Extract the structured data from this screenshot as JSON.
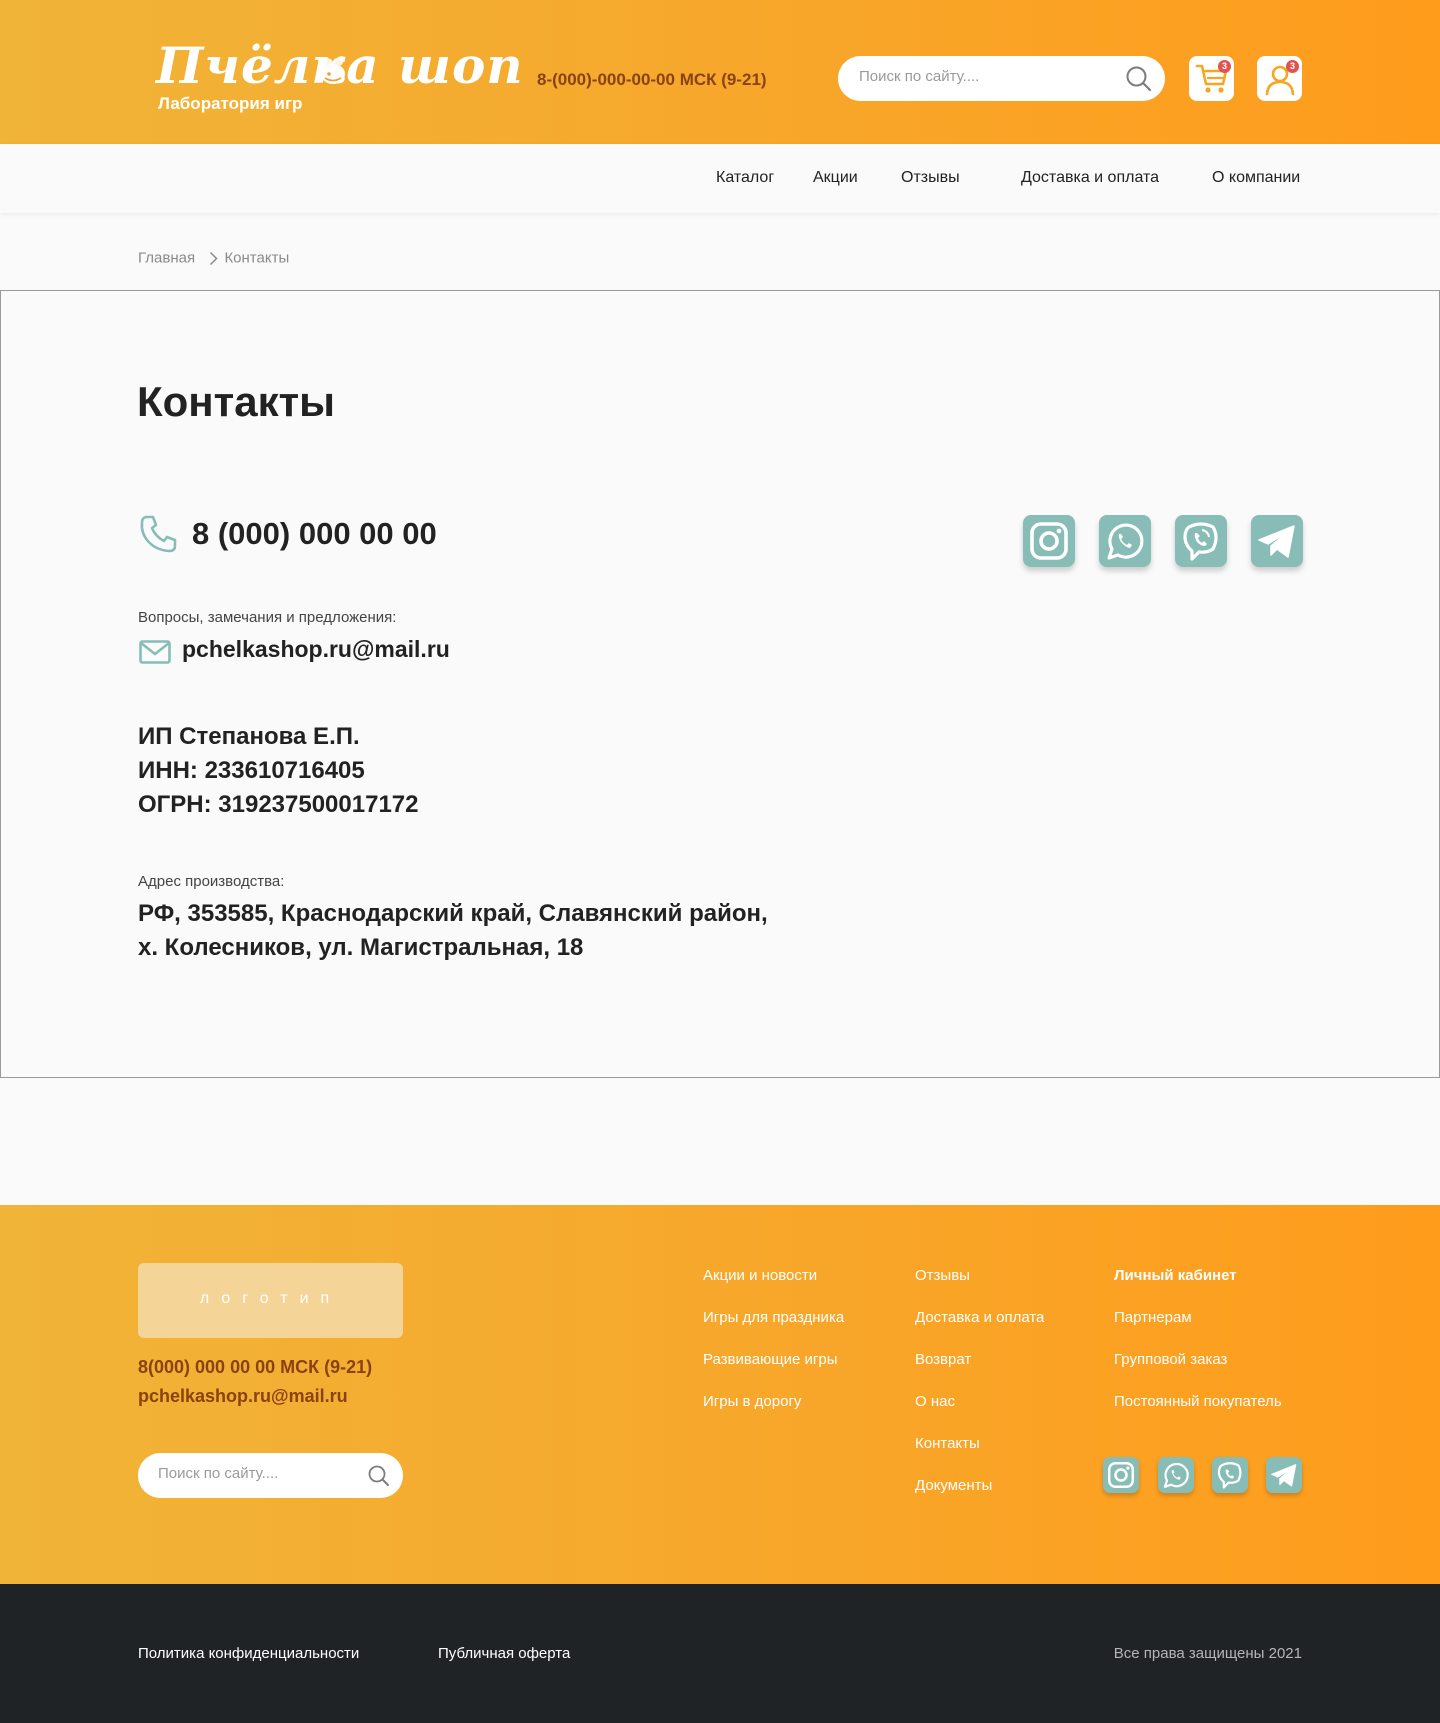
{
  "header": {
    "logo_title": "Пчёлка шоп",
    "logo_subtitle": "Лаборатория игр",
    "phone": "8-(000)-000-00-00 МСК (9-21)",
    "search_placeholder": "Поиск по сайту....",
    "cart_count": "3",
    "profile_count": "3"
  },
  "nav": {
    "items": [
      "Каталог",
      "Акции",
      "Отзывы",
      "Доставка и оплата",
      "О компании"
    ]
  },
  "breadcrumb": {
    "home": "Главная",
    "current": "Контакты"
  },
  "contacts": {
    "title": "Контакты",
    "phone": "8 (000) 000 00 00",
    "questions_label": "Вопросы, замечания и предложения:",
    "email": "pchelkashop.ru@mail.ru",
    "legal": [
      "ИП Степанова Е.П.",
      "ИНН: 233610716405",
      "ОГРН: 319237500017172"
    ],
    "address_label": "Адрес производства:",
    "address": [
      "РФ, 353585, Краснодарский край, Славянский район,",
      "х. Колесников, ул. Магистральная, 18"
    ],
    "socials": [
      "instagram-icon",
      "whatsapp-icon",
      "viber-icon",
      "telegram-icon"
    ]
  },
  "footer": {
    "logo_placeholder": "логотип",
    "phone": "8(000) 000 00 00 МСК (9-21)",
    "email": "pchelkashop.ru@mail.ru",
    "search_placeholder": "Поиск по сайту....",
    "col1": [
      "Акции и новости",
      "Игры для праздника",
      "Развивающие игры",
      "Игры в дорогу"
    ],
    "col2": [
      "Отзывы",
      "Доставка и оплата",
      "Возврат",
      "О нас",
      "Контакты",
      "Документы"
    ],
    "col3": [
      "Личный кабинет",
      "Партнерам",
      "Групповой заказ",
      "Постоянный покупатель"
    ]
  },
  "bottom": {
    "privacy": "Политика конфиденциальности",
    "offer": "Публичная оферта",
    "copyright": "Все права защищены 2021"
  },
  "colors": {
    "brand_orange": "#ff9c1c",
    "brand_yellow": "#f0b438",
    "accent_brown": "#8a4210",
    "social_teal": "#87bdb6",
    "badge_red": "#e0544e",
    "dark_bar": "#202326"
  }
}
